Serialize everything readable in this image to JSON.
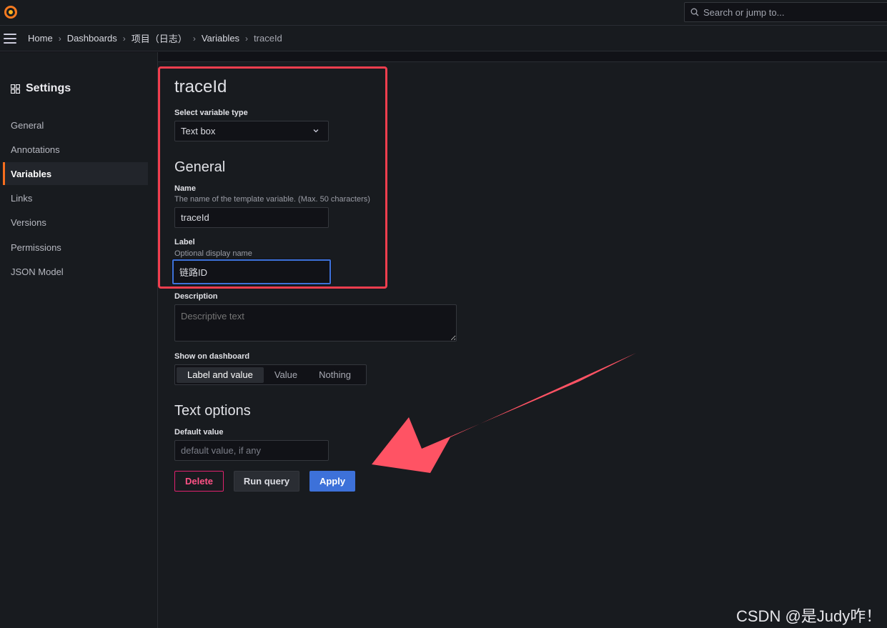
{
  "topbar": {
    "search_placeholder": "Search or jump to..."
  },
  "breadcrumb": {
    "items": [
      "Home",
      "Dashboards",
      "项目（日志）",
      "Variables",
      "traceId"
    ]
  },
  "sidebar": {
    "title": "Settings",
    "items": [
      {
        "label": "General",
        "active": false
      },
      {
        "label": "Annotations",
        "active": false
      },
      {
        "label": "Variables",
        "active": true
      },
      {
        "label": "Links",
        "active": false
      },
      {
        "label": "Versions",
        "active": false
      },
      {
        "label": "Permissions",
        "active": false
      },
      {
        "label": "JSON Model",
        "active": false
      }
    ]
  },
  "editor": {
    "title": "traceId",
    "variable_type_label": "Select variable type",
    "variable_type_value": "Text box",
    "general_heading": "General",
    "name_label": "Name",
    "name_desc": "The name of the template variable. (Max. 50 characters)",
    "name_value": "traceId",
    "label_label": "Label",
    "label_desc": "Optional display name",
    "label_value": "链路ID",
    "description_label": "Description",
    "description_placeholder": "Descriptive text",
    "show_on_dashboard_label": "Show on dashboard",
    "show_options": [
      "Label and value",
      "Value",
      "Nothing"
    ],
    "show_selected": "Label and value",
    "text_options_heading": "Text options",
    "default_value_label": "Default value",
    "default_value_placeholder": "default value, if any"
  },
  "actions": {
    "delete": "Delete",
    "run_query": "Run query",
    "apply": "Apply"
  },
  "watermark": "CSDN @是Judy咋！",
  "colors": {
    "accent_orange": "#f76e1e",
    "primary_blue": "#3d71d9",
    "delete_pink": "#ff5286",
    "annotation_red": "#f03e4e",
    "annotation_arrow": "#ff5364"
  }
}
